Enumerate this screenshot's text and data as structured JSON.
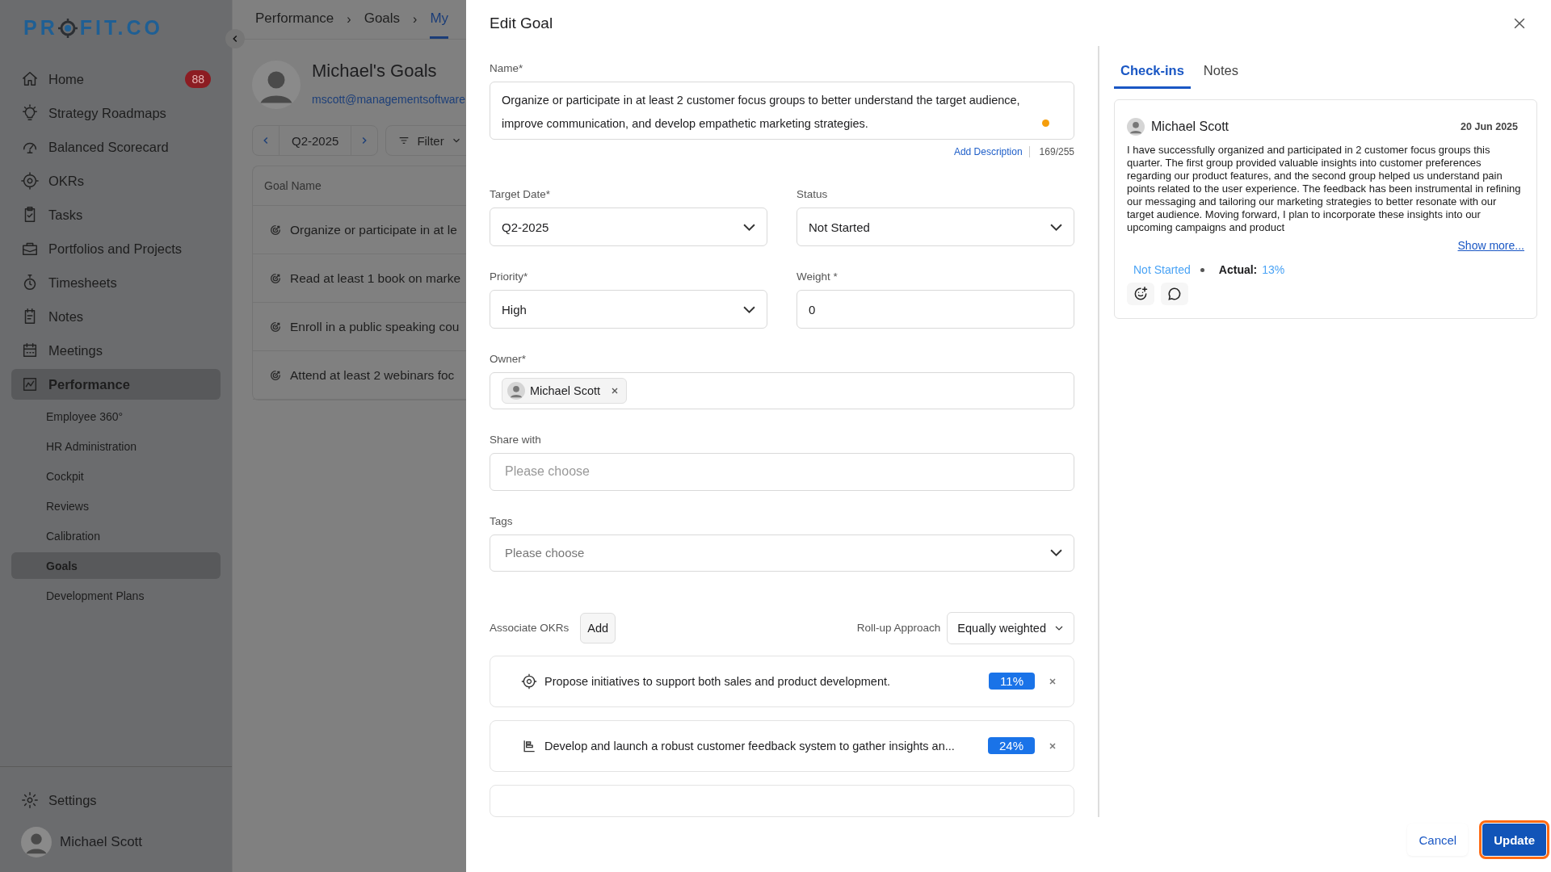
{
  "sidebar": {
    "logo": {
      "before": "PR",
      "after": "FIT.CO"
    },
    "items": [
      {
        "label": "Home",
        "badge": "88",
        "selected": false
      },
      {
        "label": "Strategy Roadmaps",
        "selected": false
      },
      {
        "label": "Balanced Scorecard",
        "selected": false
      },
      {
        "label": "OKRs",
        "selected": false
      },
      {
        "label": "Tasks",
        "selected": false
      },
      {
        "label": "Portfolios and Projects",
        "selected": false
      },
      {
        "label": "Timesheets",
        "selected": false
      },
      {
        "label": "Notes",
        "selected": false
      },
      {
        "label": "Meetings",
        "selected": false
      },
      {
        "label": "Performance",
        "selected": true,
        "children": [
          {
            "label": "Employee 360°",
            "selected": false
          },
          {
            "label": "HR Administration",
            "selected": false
          },
          {
            "label": "Cockpit",
            "selected": false
          },
          {
            "label": "Reviews",
            "selected": false
          },
          {
            "label": "Calibration",
            "selected": false
          },
          {
            "label": "Goals",
            "selected": true
          },
          {
            "label": "Development Plans",
            "selected": false
          }
        ]
      }
    ],
    "settings": "Settings",
    "user": "Michael Scott"
  },
  "page": {
    "breadcrumbs": [
      {
        "label": "Performance",
        "selected": false,
        "separator": "›"
      },
      {
        "label": "Goals",
        "selected": false,
        "separator": "›"
      },
      {
        "label": "My",
        "selected": true
      }
    ],
    "title": "Michael's Goals",
    "email": "mscott@managementsoftware",
    "period": "Q2-2025",
    "filter": "Filter",
    "table": {
      "columns": [
        "Goal Name"
      ],
      "rows": [
        "Organize or participate in at le",
        "Read at least 1 book on marke",
        "Enroll in a public speaking cou",
        "Attend at least 2 webinars foc"
      ]
    }
  },
  "drawer": {
    "title": "Edit Goal",
    "form": {
      "name": {
        "label": "Name*",
        "value": "Organize or participate in at least 2 customer focus groups to better understand the target audience, improve communication, and develop empathetic marketing strategies.",
        "action": "Add Description",
        "counter": "169/255"
      },
      "target_date": {
        "label": "Target Date*",
        "value": "Q2-2025"
      },
      "status": {
        "label": "Status",
        "value": "Not Started"
      },
      "priority": {
        "label": "Priority*",
        "value": "High"
      },
      "weight": {
        "label": "Weight *",
        "value": "0"
      },
      "owner": {
        "label": "Owner*",
        "chips": [
          {
            "name": "Michael Scott"
          }
        ]
      },
      "share_with": {
        "label": "Share with",
        "placeholder": "Please choose"
      },
      "tags": {
        "label": "Tags",
        "placeholder": "Please choose"
      },
      "okrs": {
        "label": "Associate OKRs",
        "add": "Add",
        "rollup_label": "Roll-up Approach",
        "rollup": "Equally weighted",
        "items": [
          {
            "kind": "objective",
            "title": "Propose initiatives to support both sales and product development.",
            "percent": "11%"
          },
          {
            "kind": "key_result",
            "title": "Develop and launch a robust customer feedback system to gather insights an...",
            "percent": "24%"
          }
        ]
      }
    },
    "checkins": {
      "tabs": [
        {
          "label": "Check-ins",
          "selected": true
        },
        {
          "label": "Notes",
          "selected": false
        }
      ],
      "entries": [
        {
          "author": "Michael Scott",
          "date": "20 Jun 2025",
          "text": "I have successfully organized and participated in 2 customer focus groups this quarter. The first group provided valuable insights into customer preferences regarding our product features, and the second group helped us understand pain points related to the user experience. The feedback has been instrumental in refining our messaging and tailoring our marketing strategies to better resonate with our target audience. Moving forward, I plan to incorporate these insights into our upcoming campaigns and product",
          "more": "Show more...",
          "status": "Not Started",
          "actual_label": "Actual:",
          "actual": "13%"
        }
      ]
    },
    "buttons": {
      "cancel": "Cancel",
      "update": "Update",
      "update_highlighted": true
    }
  }
}
